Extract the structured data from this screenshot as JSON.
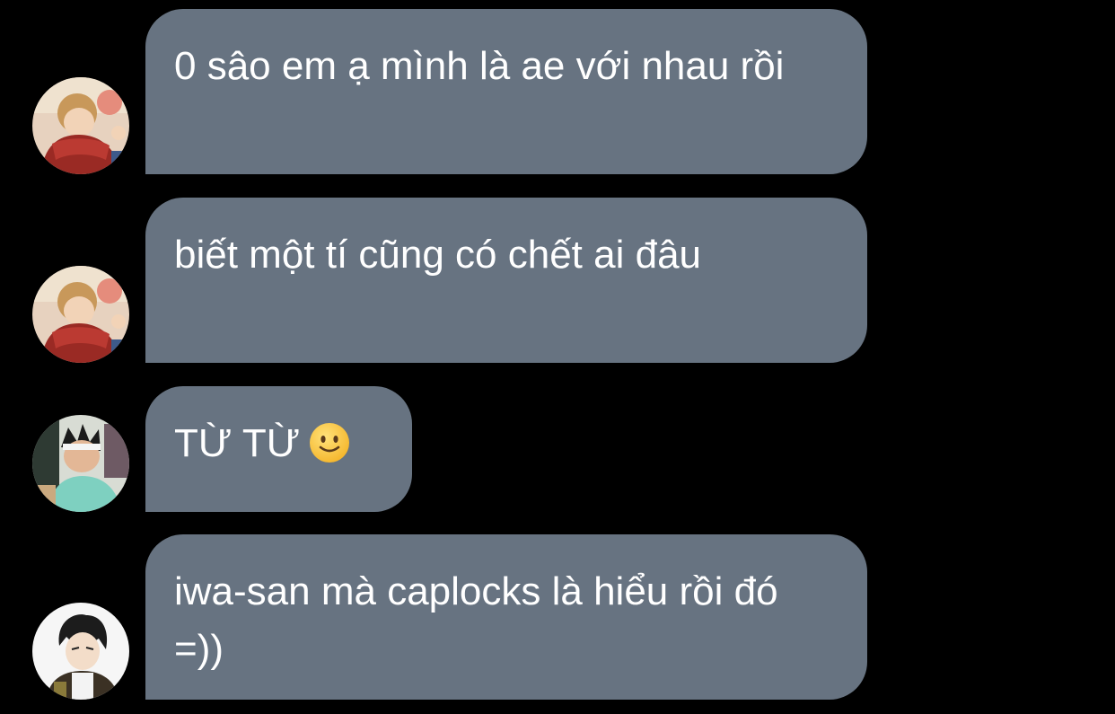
{
  "messages": [
    {
      "avatar": "avatar-blond-scarf",
      "text": "0 sâo em ạ mình là ae với nhau rồi"
    },
    {
      "avatar": "avatar-blond-scarf",
      "text": "biết một tí cũng có chết ai đâu"
    },
    {
      "avatar": "avatar-headband-boy",
      "text": "TỪ TỪ",
      "emoji": "slightly-smiling-face-icon"
    },
    {
      "avatar": "avatar-dark-hair-boy",
      "text": "iwa-san mà caplocks là hiểu rồi đó =))"
    }
  ],
  "colors": {
    "background": "#000000",
    "bubble": "#677381",
    "text": "#ffffff"
  }
}
